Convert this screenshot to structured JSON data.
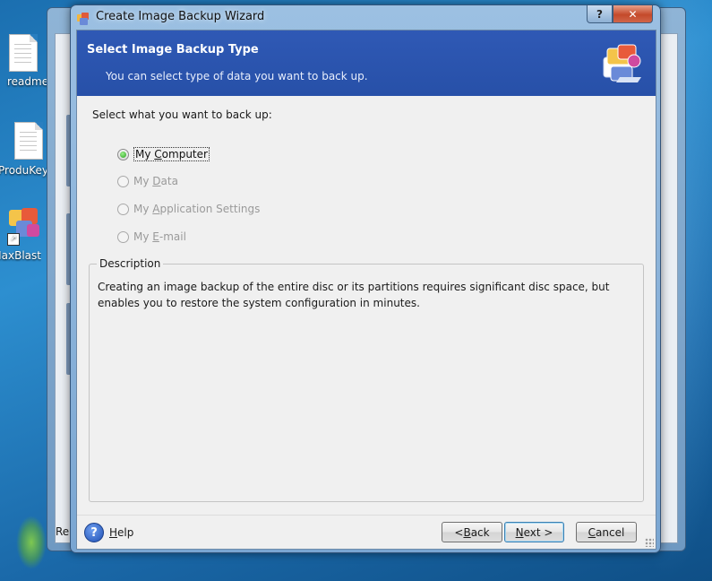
{
  "desktop": {
    "icons": [
      {
        "label": "readme",
        "icon": "document-icon"
      },
      {
        "label": "ProduKey",
        "icon": "document-icon"
      },
      {
        "label": "Maxtor MaxBlast",
        "icon": "maxblast-app-icon"
      }
    ],
    "background_window": {
      "status_text": "Re"
    }
  },
  "wizard": {
    "title": "Create Image Backup Wizard",
    "titlebar_buttons": {
      "help": "?",
      "close": "✕"
    },
    "header": {
      "title": "Select Image Backup Type",
      "subtitle": "You can select type of data you want to back up."
    },
    "prompt": "Select what you want to back up:",
    "options": [
      {
        "pre": "My ",
        "key": "C",
        "post": "omputer",
        "selected": true,
        "enabled": true
      },
      {
        "pre": "My ",
        "key": "D",
        "post": "ata",
        "selected": false,
        "enabled": false
      },
      {
        "pre": "My ",
        "key": "A",
        "post": "pplication Settings",
        "selected": false,
        "enabled": false
      },
      {
        "pre": "My ",
        "key": "E",
        "post": "-mail",
        "selected": false,
        "enabled": false
      }
    ],
    "description": {
      "legend": "Description",
      "text": "Creating an image backup of the entire disc or its partitions requires significant disc space, but enables you to restore the system configuration in minutes."
    },
    "footer": {
      "help": {
        "key": "H",
        "post": "elp"
      },
      "back": {
        "pre": "< ",
        "key": "B",
        "post": "ack"
      },
      "next": {
        "key": "N",
        "post": "ext >"
      },
      "cancel": {
        "key": "C",
        "post": "ancel"
      }
    }
  },
  "colors": {
    "header_bg": "#2f59b5",
    "selected_radio": "#2aa020",
    "default_button_border": "#3c7fb1"
  }
}
